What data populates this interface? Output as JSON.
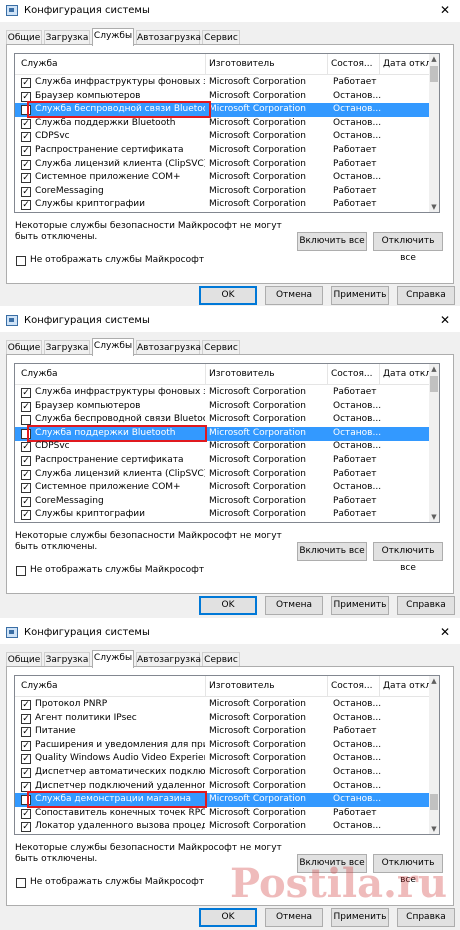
{
  "window_title": "Конфигурация системы",
  "close_glyph": "✕",
  "tabs": [
    "Общие",
    "Загрузка",
    "Службы",
    "Автозагрузка",
    "Сервис"
  ],
  "columns": [
    "Служба",
    "Изготовитель",
    "Состоя...",
    "Дата отклю..."
  ],
  "check_glyph": "✓",
  "note": "Некоторые службы безопасности Майкрософт не могут быть отключены.",
  "enable_all": "Включить все",
  "disable_all": "Отключить все",
  "hide_ms": "Не отображать службы Майкрософт",
  "buttons": {
    "ok": "OK",
    "cancel": "Отмена",
    "apply": "Применить",
    "help": "Справка"
  },
  "watermark": "Postila.ru",
  "colors": {
    "selection": "#3399ff",
    "highlight_box": "#e0191f",
    "default_button": "#0078d7"
  },
  "panels": [
    {
      "selected_index": 2,
      "rows": [
        {
          "name": "Служба инфраструктуры фоновых з...",
          "maker": "Microsoft Corporation",
          "status": "Работает",
          "checked": true
        },
        {
          "name": "Браузер компьютеров",
          "maker": "Microsoft Corporation",
          "status": "Останов...",
          "checked": true
        },
        {
          "name": "Служба беспроводной связи Bluetooth",
          "maker": "Microsoft Corporation",
          "status": "Останов...",
          "checked": false
        },
        {
          "name": "Служба поддержки Bluetooth",
          "maker": "Microsoft Corporation",
          "status": "Останов...",
          "checked": true
        },
        {
          "name": "CDPSvc",
          "maker": "Microsoft Corporation",
          "status": "Останов...",
          "checked": true
        },
        {
          "name": "Распространение сертификата",
          "maker": "Microsoft Corporation",
          "status": "Работает",
          "checked": true
        },
        {
          "name": "Служба лицензий клиента (ClipSVC)",
          "maker": "Microsoft Corporation",
          "status": "Работает",
          "checked": true
        },
        {
          "name": "Системное приложение COM+",
          "maker": "Microsoft Corporation",
          "status": "Останов...",
          "checked": true
        },
        {
          "name": "CoreMessaging",
          "maker": "Microsoft Corporation",
          "status": "Работает",
          "checked": true
        },
        {
          "name": "Службы криптографии",
          "maker": "Microsoft Corporation",
          "status": "Работает",
          "checked": true
        }
      ]
    },
    {
      "selected_index": 3,
      "rows": [
        {
          "name": "Служба инфраструктуры фоновых з...",
          "maker": "Microsoft Corporation",
          "status": "Работает",
          "checked": true
        },
        {
          "name": "Браузер компьютеров",
          "maker": "Microsoft Corporation",
          "status": "Останов...",
          "checked": true
        },
        {
          "name": "Служба беспроводной связи Bluetooth",
          "maker": "Microsoft Corporation",
          "status": "Останов...",
          "checked": false
        },
        {
          "name": "Служба поддержки Bluetooth",
          "maker": "Microsoft Corporation",
          "status": "Останов...",
          "checked": false
        },
        {
          "name": "CDPSvc",
          "maker": "Microsoft Corporation",
          "status": "Останов...",
          "checked": true
        },
        {
          "name": "Распространение сертификата",
          "maker": "Microsoft Corporation",
          "status": "Работает",
          "checked": true
        },
        {
          "name": "Служба лицензий клиента (ClipSVC)",
          "maker": "Microsoft Corporation",
          "status": "Работает",
          "checked": true
        },
        {
          "name": "Системное приложение COM+",
          "maker": "Microsoft Corporation",
          "status": "Останов...",
          "checked": true
        },
        {
          "name": "CoreMessaging",
          "maker": "Microsoft Corporation",
          "status": "Работает",
          "checked": true
        },
        {
          "name": "Службы криптографии",
          "maker": "Microsoft Corporation",
          "status": "Работает",
          "checked": true
        }
      ]
    },
    {
      "selected_index": 7,
      "rows": [
        {
          "name": "Протокол PNRP",
          "maker": "Microsoft Corporation",
          "status": "Останов...",
          "checked": true
        },
        {
          "name": "Агент политики IPsec",
          "maker": "Microsoft Corporation",
          "status": "Останов...",
          "checked": true
        },
        {
          "name": "Питание",
          "maker": "Microsoft Corporation",
          "status": "Работает",
          "checked": true
        },
        {
          "name": "Расширения и уведомления для при...",
          "maker": "Microsoft Corporation",
          "status": "Останов...",
          "checked": true
        },
        {
          "name": "Quality Windows Audio Video Experience",
          "maker": "Microsoft Corporation",
          "status": "Останов...",
          "checked": true
        },
        {
          "name": "Диспетчер автоматических подклю...",
          "maker": "Microsoft Corporation",
          "status": "Останов...",
          "checked": true
        },
        {
          "name": "Диспетчер подключений удаленног...",
          "maker": "Microsoft Corporation",
          "status": "Останов...",
          "checked": true
        },
        {
          "name": "Служба демонстрации магазина",
          "maker": "Microsoft Corporation",
          "status": "Останов...",
          "checked": false
        },
        {
          "name": "Сопоставитель конечных точек RPC",
          "maker": "Microsoft Corporation",
          "status": "Работает",
          "checked": true
        },
        {
          "name": "Локатор удаленного вызова процед...",
          "maker": "Microsoft Corporation",
          "status": "Останов...",
          "checked": true
        }
      ]
    }
  ]
}
